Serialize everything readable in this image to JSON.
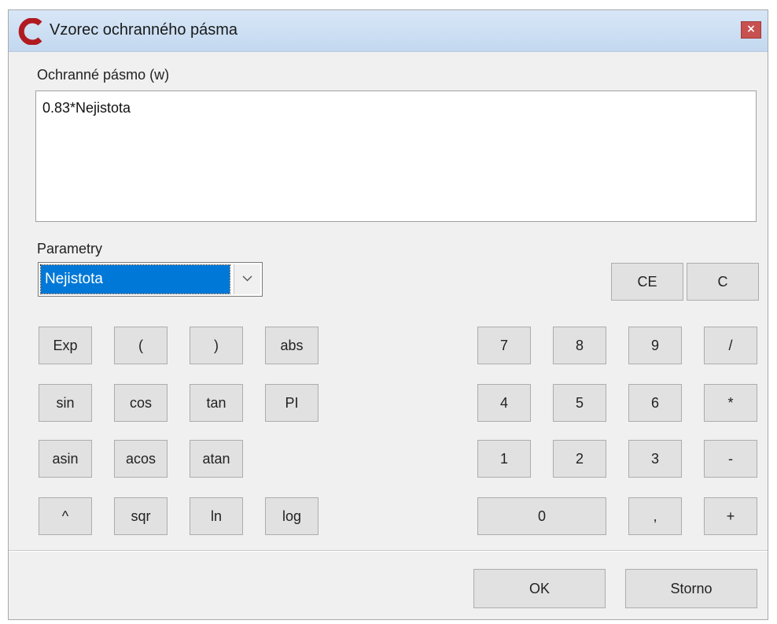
{
  "window": {
    "title": "Vzorec ochranného pásma",
    "close_label": "×"
  },
  "formula": {
    "label": "Ochranné pásmo (w)",
    "value": "0.83*Nejistota"
  },
  "parameters": {
    "label": "Parametry",
    "selected": "Nejistota"
  },
  "clear": {
    "ce": "CE",
    "c": "C"
  },
  "functions": {
    "exp": "Exp",
    "lparen": "(",
    "rparen": ")",
    "abs": "abs",
    "sin": "sin",
    "cos": "cos",
    "tan": "tan",
    "pi": "PI",
    "asin": "asin",
    "acos": "acos",
    "atan": "atan",
    "pow": "^",
    "sqr": "sqr",
    "ln": "ln",
    "log": "log"
  },
  "keypad": {
    "k7": "7",
    "k8": "8",
    "k9": "9",
    "div": "/",
    "k4": "4",
    "k5": "5",
    "k6": "6",
    "mul": "*",
    "k1": "1",
    "k2": "2",
    "k3": "3",
    "sub": "-",
    "k0": "0",
    "comma": ",",
    "add": "+"
  },
  "footer": {
    "ok": "OK",
    "cancel": "Storno"
  }
}
